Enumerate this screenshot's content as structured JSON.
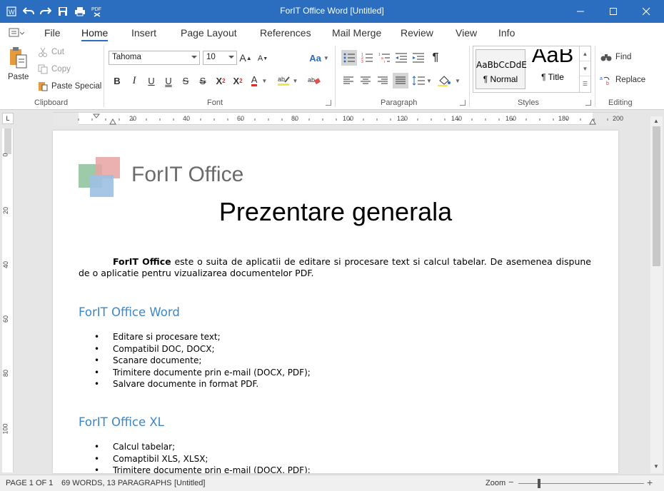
{
  "window": {
    "title": "ForIT Office Word [Untitled]"
  },
  "menu": {
    "items": [
      "File",
      "Home",
      "Insert",
      "Page Layout",
      "References",
      "Mail Merge",
      "Review",
      "View",
      "Info"
    ],
    "active": "Home"
  },
  "clipboard": {
    "paste": "Paste",
    "cut": "Cut",
    "copy": "Copy",
    "paste_special": "Paste Special",
    "label": "Clipboard"
  },
  "font": {
    "name": "Tahoma",
    "size": "10",
    "label": "Font",
    "bold": "B",
    "italic": "I",
    "underline": "U",
    "double_underline": "U",
    "strike": "S",
    "double_strike": "S",
    "superscript": "X",
    "subscript": "X",
    "case_aa": "Aa",
    "grow": "A",
    "shrink": "A",
    "color_a": "A"
  },
  "paragraph": {
    "label": "Paragraph",
    "pilcrow": "¶"
  },
  "styles": {
    "label": "Styles",
    "normal_preview": "AaBbCcDdE",
    "normal_name": "¶ Normal",
    "title_preview": "AaB",
    "title_name": "¶ Title"
  },
  "editing": {
    "label": "Editing",
    "find": "Find",
    "replace": "Replace"
  },
  "ruler": {
    "h_ticks": [
      "20",
      "40",
      "60",
      "80",
      "100",
      "120",
      "140",
      "160",
      "180",
      "200"
    ],
    "v_ticks": [
      "0",
      "20",
      "40",
      "60",
      "80",
      "100"
    ],
    "corner": "L"
  },
  "document": {
    "logo_text": "ForIT Office",
    "title": "Prezentare generala",
    "intro_bold": "ForIT Office",
    "intro_rest": " este o suita de aplicatii de editare si procesare text si calcul tabelar. De asemenea dispune de o aplicatie pentru vizualizarea documentelor PDF.",
    "section1_heading": "ForIT Office Word",
    "section1_items": [
      "Editare si procesare text;",
      "Compatibil DOC, DOCX;",
      "Scanare documente;",
      "Trimitere documente prin e-mail (DOCX, PDF);",
      "Salvare documente in format PDF."
    ],
    "section2_heading": "ForIT Office XL",
    "section2_items": [
      "Calcul tabelar;",
      "Comaptibil XLS, XLSX;",
      "Trimitere documente prin e-mail (DOCX, PDF);"
    ]
  },
  "status": {
    "page": "PAGE 1 OF 1",
    "words": "69 WORDS, 13 PARAGRAPHS",
    "doc": "[Untitled]",
    "zoom": "Zoom"
  },
  "colors": {
    "accent": "#2b6dbf",
    "heading": "#3d86c6",
    "logo_green": "#8cc19a",
    "logo_red": "#e7a3a3",
    "logo_blue": "#9dc0e3"
  }
}
